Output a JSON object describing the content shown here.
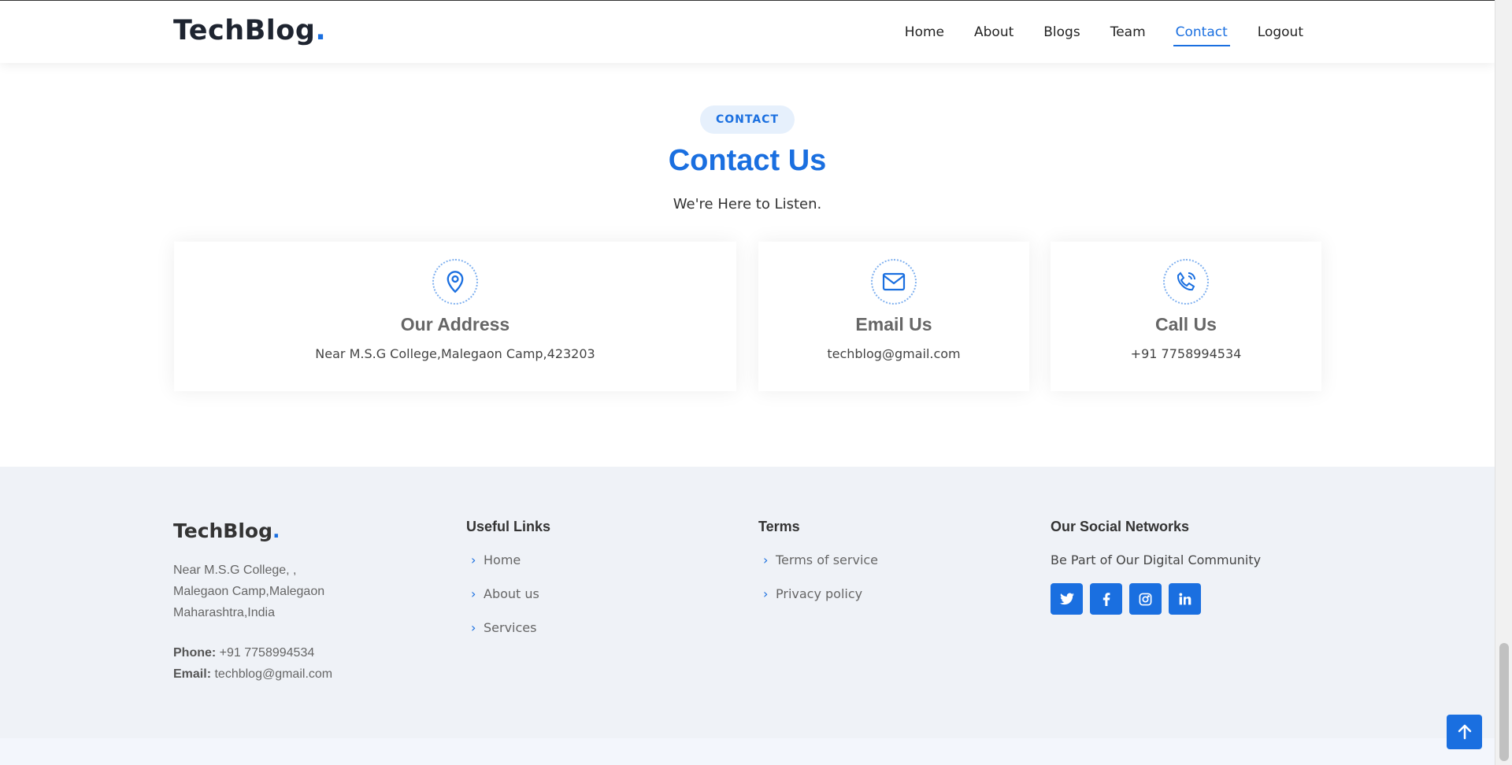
{
  "header": {
    "logo": "TechBlog",
    "logo_dot": ".",
    "nav": [
      {
        "label": "Home"
      },
      {
        "label": "About"
      },
      {
        "label": "Blogs"
      },
      {
        "label": "Team"
      },
      {
        "label": "Contact",
        "active": true
      },
      {
        "label": "Logout"
      }
    ]
  },
  "contact": {
    "badge": "CONTACT",
    "title": "Contact Us",
    "subtitle": "We're Here to Listen.",
    "cards": [
      {
        "icon": "map-pin-icon",
        "title": "Our Address",
        "text": "Near M.S.G College,Malegaon Camp,423203"
      },
      {
        "icon": "envelope-icon",
        "title": "Email Us",
        "text": "techblog@gmail.com"
      },
      {
        "icon": "phone-icon",
        "title": "Call Us",
        "text": "+91 7758994534"
      }
    ]
  },
  "footer": {
    "logo": "TechBlog",
    "logo_dot": ".",
    "address_lines": [
      "Near M.S.G College, ,",
      "Malegaon Camp,Malegaon",
      "Maharashtra,India"
    ],
    "phone_label": "Phone:",
    "phone": "+91 7758994534",
    "email_label": "Email:",
    "email": "techblog@gmail.com",
    "useful_links": {
      "heading": "Useful Links",
      "items": [
        "Home",
        "About us",
        "Services"
      ]
    },
    "terms": {
      "heading": "Terms",
      "items": [
        "Terms of service",
        "Privacy policy"
      ]
    },
    "social": {
      "heading": "Our Social Networks",
      "text": "Be Part of Our Digital Community",
      "icons": [
        "twitter-icon",
        "facebook-icon",
        "instagram-icon",
        "linkedin-icon"
      ]
    },
    "copyright": ""
  },
  "colors": {
    "accent": "#1a6fe0",
    "footer_bg": "#eff2f7"
  }
}
